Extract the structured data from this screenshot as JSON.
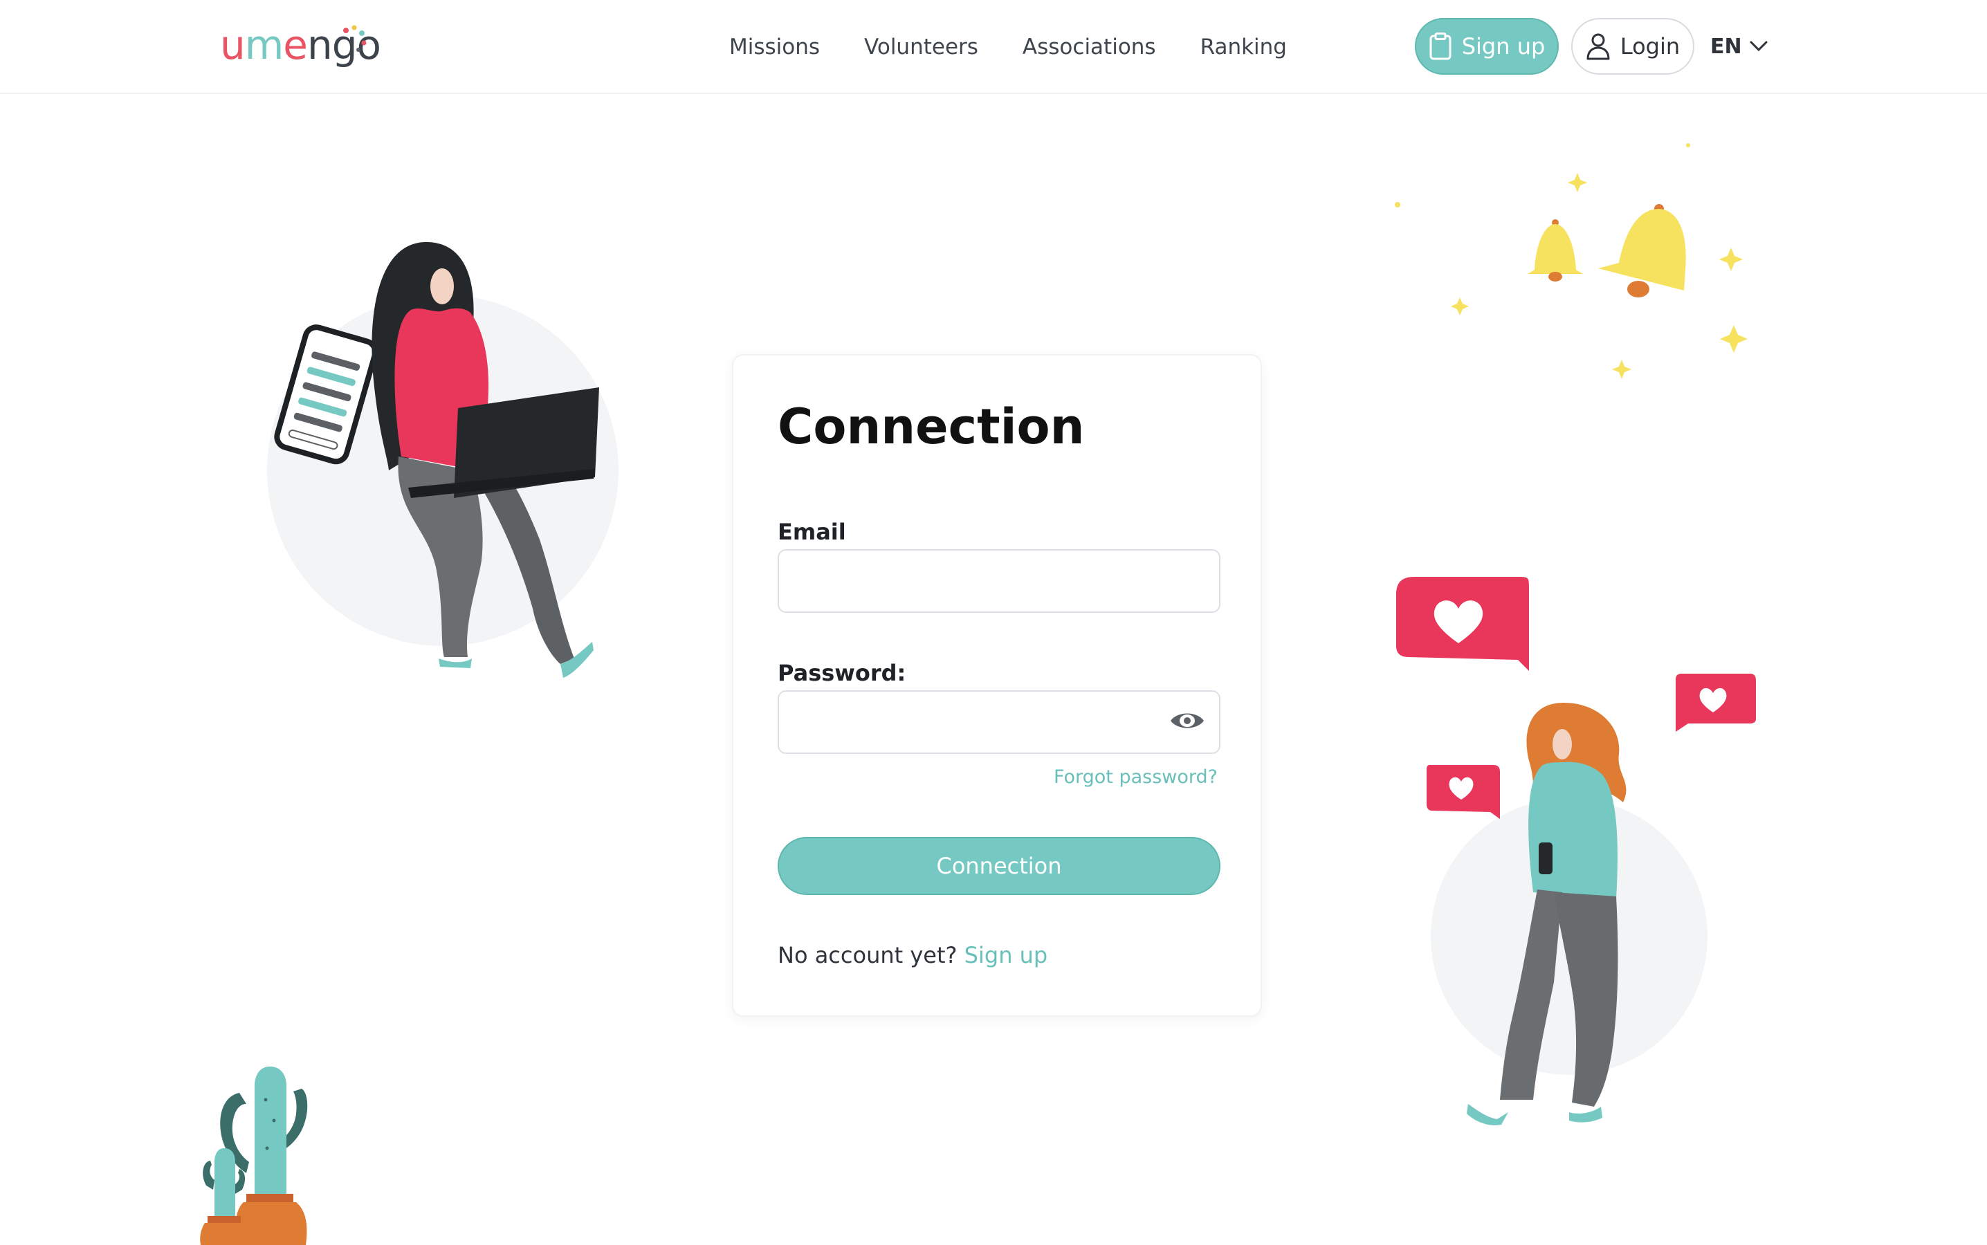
{
  "header": {
    "logo": {
      "u": "u",
      "m": "m",
      "e": "e",
      "ngo": "ngo"
    },
    "nav": [
      "Missions",
      "Volunteers",
      "Associations",
      "Ranking"
    ],
    "signup_label": "Sign up",
    "login_label": "Login",
    "language": "EN"
  },
  "form": {
    "title": "Connection",
    "email_label": "Email",
    "email_value": "",
    "password_label": "Password:",
    "password_value": "",
    "forgot_label": "Forgot password?",
    "submit_label": "Connection",
    "no_account_text": "No account yet?",
    "signup_link": "Sign up"
  },
  "colors": {
    "accent": "#75c9c2",
    "pink": "#e8375a",
    "orange": "#de7c34",
    "yellow": "#f6e25e",
    "dark": "#25282b",
    "grey": "#6b6e71"
  },
  "icons": {
    "signup": "clipboard-icon",
    "login": "user-icon",
    "language": "chevron-down-icon",
    "password_toggle": "eye-icon"
  }
}
